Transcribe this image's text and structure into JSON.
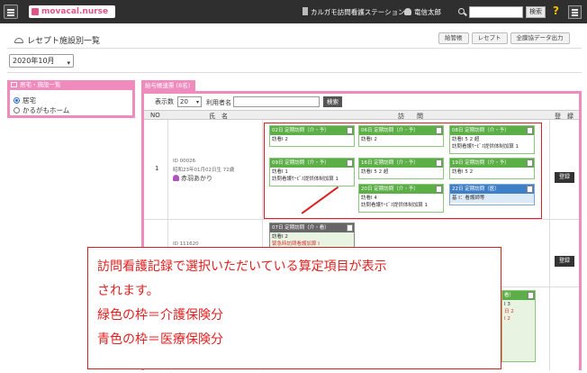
{
  "topbar": {
    "logo": "movacal.nurse",
    "station": "カルガモ訪問看護ステーション",
    "user": "竜信太郎",
    "search_button": "検索",
    "help": "?"
  },
  "page": {
    "title": "レセプト施設別一覧",
    "buttons": [
      "給管帳",
      "レセプト",
      "全膜協データ出力"
    ],
    "month": "2020年10月"
  },
  "left_panel": {
    "title": "居宅・施設一覧",
    "options": [
      {
        "label": "居宅",
        "selected": true
      },
      {
        "label": "かるがもホーム",
        "selected": false
      }
    ]
  },
  "right_panel": {
    "title": "給与帳速票 (8名)",
    "display_count_label": "表示数",
    "display_count": "20",
    "user_name_label": "利用者名",
    "search_button": "検索",
    "columns": {
      "no": "NO",
      "name": "氏　名",
      "visits": "訪　　問",
      "register": "登　録"
    }
  },
  "rows": [
    {
      "no": "1",
      "id": "ID 00026",
      "dob": "昭和23年01月02日生 72歳",
      "name": "赤羽あかり",
      "register": "登録",
      "visits": [
        {
          "header": "02日 定期訪問（介・予）",
          "lines": [
            "訪看I 2"
          ],
          "type": "green"
        },
        {
          "header": "06日 定期訪問（介・予）",
          "lines": [
            "訪看I 2"
          ],
          "type": "green"
        },
        {
          "header": "08日 定期訪問（介・予）",
          "lines": [
            "訪看I 5 2 超",
            "訪問看護ｻｰﾋﾞｽ提供体制加算 1"
          ],
          "type": "green"
        },
        {
          "header": "09日 定期訪問（介・予）",
          "lines": [
            "訪看I 1",
            "訪問看護ｻｰﾋﾞｽ提供体制加算 1"
          ],
          "type": "green"
        },
        {
          "header": "16日 定期訪問（介・予）",
          "lines": [
            "訪看I 5 2 超"
          ],
          "type": "green"
        },
        {
          "header": "19日 定期訪問（介・予）",
          "lines": [
            "訪看I 5 2"
          ],
          "type": "green"
        },
        {
          "header": "20日 定期訪問（介・予）",
          "lines": [
            "訪看I 4",
            "訪問看護ｻｰﾋﾞｽ提供体制加算 1"
          ],
          "type": "green"
        },
        {
          "header": "22日 定期訪問（医）",
          "lines": [
            "基 I：看護師等"
          ],
          "type": "blue"
        }
      ]
    },
    {
      "id": "ID 111620",
      "register": "登録",
      "visits": [
        {
          "header": "07日 定期訪問（介・看）",
          "lines": [
            "訪看I 2",
            "緊急時訪問看護加算 I"
          ],
          "type": "dark"
        }
      ]
    },
    {
      "visits": [
        {
          "header": "看）",
          "lines": [
            "I 3",
            "日 2",
            "I 2"
          ],
          "type": "green"
        }
      ]
    }
  ],
  "callout": {
    "lines": [
      "訪問看護記録で選択いただいている算定項目が表示",
      "されます。",
      "緑色の枠＝介護保険分",
      "青色の枠＝医療保険分"
    ]
  }
}
